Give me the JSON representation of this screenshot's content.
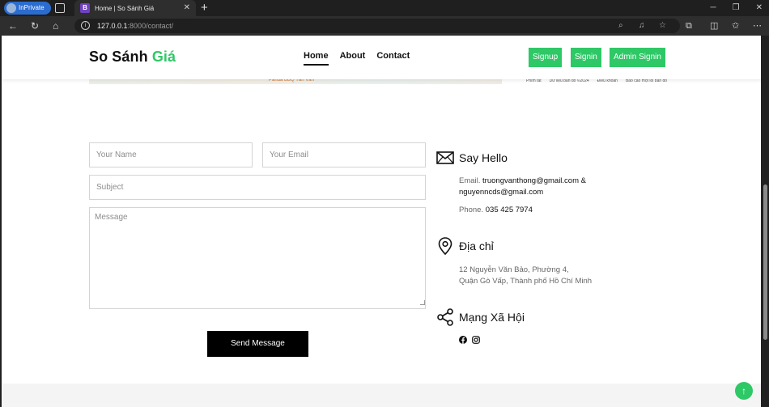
{
  "browser": {
    "inprivate_label": "InPrivate",
    "tab_favicon_letter": "B",
    "tab_title": "Home | So Sánh Giá",
    "url_host": "127.0.0.1",
    "url_path": ":8000/contact/"
  },
  "header": {
    "brand_main": "So Sánh",
    "brand_accent": "Giá",
    "nav": {
      "home": "Home",
      "about": "About",
      "contact": "Contact"
    },
    "buttons": {
      "signup": "Signup",
      "signin": "Signin",
      "admin_signin": "Admin Signin"
    }
  },
  "map_strip": {
    "pin_text": "Panda BBQ Tân Văn",
    "links": [
      "Phím tắt",
      "Dữ liệu bản đồ ©2024",
      "Điều khoản",
      "Báo cáo một lỗi bản đồ"
    ]
  },
  "form": {
    "name_placeholder": "Your Name",
    "email_placeholder": "Your Email",
    "subject_placeholder": "Subject",
    "message_placeholder": "Message",
    "send_label": "Send Message"
  },
  "contact": {
    "hello_title": "Say Hello",
    "email_label": "Email.",
    "email_value_1": "truongvanthong@gmail.com &",
    "email_value_2": "nguyenncds@gmail.com",
    "phone_label": "Phone.",
    "phone_value": "035 425 7974",
    "address_title": "Địa chỉ",
    "address_line_1": "12 Nguyễn Văn Bảo, Phường 4,",
    "address_line_2": "Quận Gò Vấp, Thành phố Hồ Chí Minh",
    "social_title": "Mạng Xã Hội"
  },
  "colors": {
    "accent": "#2ec866",
    "button_dark": "#000000"
  }
}
